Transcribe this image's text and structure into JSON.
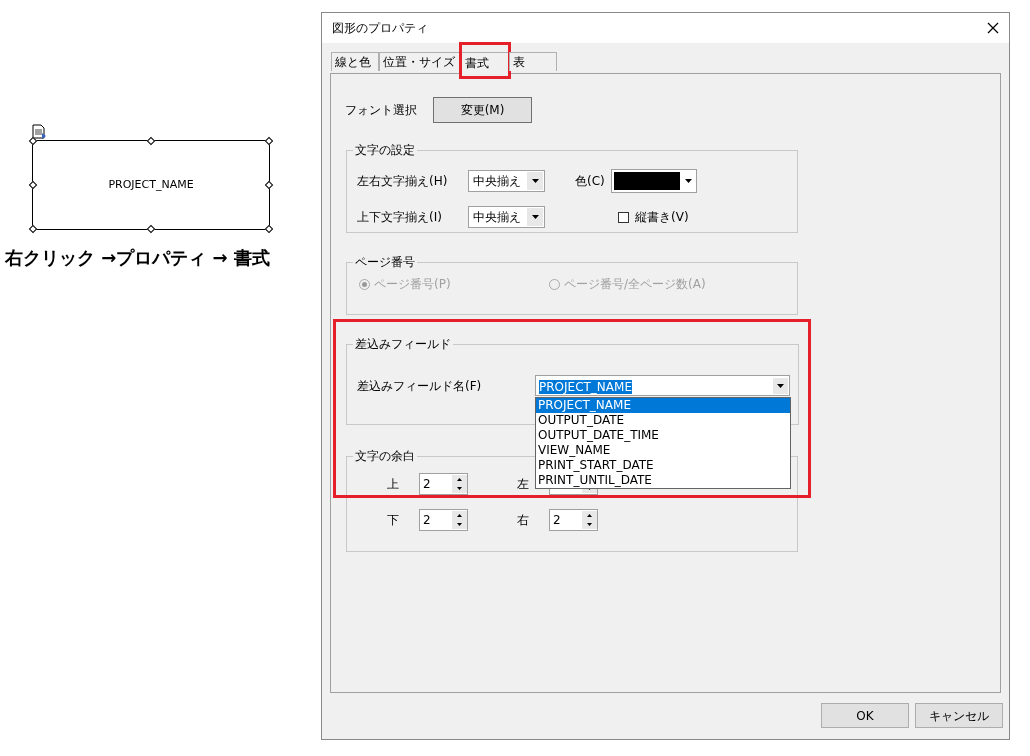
{
  "canvas": {
    "shape_text": "PROJECT_NAME",
    "caption": "右クリック →プロパティ → 書式"
  },
  "dialog": {
    "title": "図形のプロパティ",
    "tabs": [
      {
        "label": "線と色",
        "selected": false
      },
      {
        "label": "位置・サイズ",
        "selected": false
      },
      {
        "label": "書式",
        "selected": true
      },
      {
        "label": "表",
        "selected": false
      }
    ],
    "font": {
      "label": "フォント選択",
      "button": "変更(M)"
    },
    "text_settings": {
      "title": "文字の設定",
      "h_align": {
        "label": "左右文字揃え(H)",
        "value": "中央揃え"
      },
      "v_align": {
        "label": "上下文字揃え(I)",
        "value": "中央揃え"
      },
      "color": {
        "label": "色(C)",
        "color": "#000000"
      },
      "vertical": {
        "label": "縦書き(V)",
        "checked": false
      }
    },
    "page_number": {
      "title": "ページ番号",
      "options": [
        {
          "label": "ページ番号(P)",
          "selected": true,
          "disabled": true
        },
        {
          "label": "ページ番号/全ページ数(A)",
          "selected": false,
          "disabled": true
        }
      ]
    },
    "merge_field": {
      "title": "差込みフィールド",
      "label": "差込みフィールド名(F)",
      "value": "PROJECT_NAME",
      "expanded": true,
      "options": [
        {
          "label": "PROJECT_NAME",
          "selected": true
        },
        {
          "label": "OUTPUT_DATE",
          "selected": false
        },
        {
          "label": "OUTPUT_DATE_TIME",
          "selected": false
        },
        {
          "label": "VIEW_NAME",
          "selected": false
        },
        {
          "label": "PRINT_START_DATE",
          "selected": false
        },
        {
          "label": "PRINT_UNTIL_DATE",
          "selected": false
        }
      ]
    },
    "margins": {
      "title": "文字の余白",
      "fields": [
        {
          "label": "上",
          "value": "2"
        },
        {
          "label": "左"
        },
        {
          "label": "下",
          "value": "2"
        },
        {
          "label": "右",
          "value": "2"
        }
      ]
    },
    "buttons": [
      "OK",
      "キャンセル"
    ]
  }
}
